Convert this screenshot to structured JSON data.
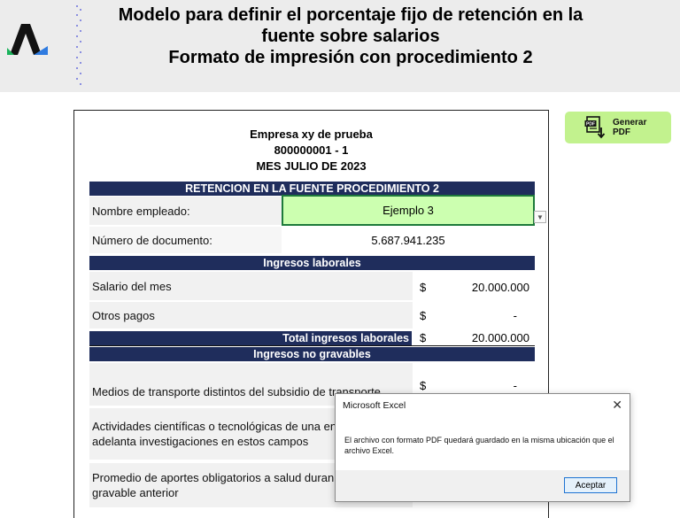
{
  "header": {
    "title_line1": "Modelo para definir el porcentaje fijo de retención en la",
    "title_line2": "fuente sobre salarios",
    "title_line3": "Formato de impresión con procedimiento 2"
  },
  "company": {
    "name": "Empresa xy de prueba",
    "nit": "800000001 - 1",
    "period": "MES JULIO DE 2023"
  },
  "sections": {
    "retencion": "RETENCION EN LA FUENTE PROCEDIMIENTO 2",
    "ingresos_laborales": "Ingresos laborales",
    "total_ingresos_label": "Total ingresos laborales",
    "ingresos_no_gravables": "Ingresos no gravables"
  },
  "fields": {
    "nombre_label": "Nombre empleado:",
    "nombre_value": "Ejemplo 3",
    "documento_label": "Número de documento:",
    "documento_value": "5.687.941.235"
  },
  "ingresos": {
    "salario_label": "Salario del mes",
    "salario_currency": "$",
    "salario_value": "20.000.000",
    "otros_label": "Otros pagos",
    "otros_currency": "$",
    "otros_value": "-",
    "total_currency": "$",
    "total_value": "20.000.000"
  },
  "no_gravables": {
    "transporte_label": "Medios de transporte distintos del subsidio de transporte",
    "transporte_currency": "$",
    "transporte_value": "-",
    "actividades_line1": "Actividades científicas o tecnológicas de una en",
    "actividades_line2": "adelanta investigaciones en estos campos",
    "promedio_line1": "Promedio de aportes obligatorios a salud duran",
    "promedio_line2": "gravable anterior"
  },
  "pdf_button": {
    "line1": "Generar",
    "line2": "PDF",
    "icon": "pdf-download-icon"
  },
  "dialog": {
    "title": "Microsoft Excel",
    "close": "✕",
    "message": "El archivo con formato PDF quedará guardado en la misma ubicación que el archivo Excel.",
    "ok_label": "Aceptar"
  },
  "colors": {
    "band": "#1f2d5c",
    "input_green": "#ccffb0",
    "button_green": "#c2f28e",
    "header_bg": "#ececec"
  }
}
